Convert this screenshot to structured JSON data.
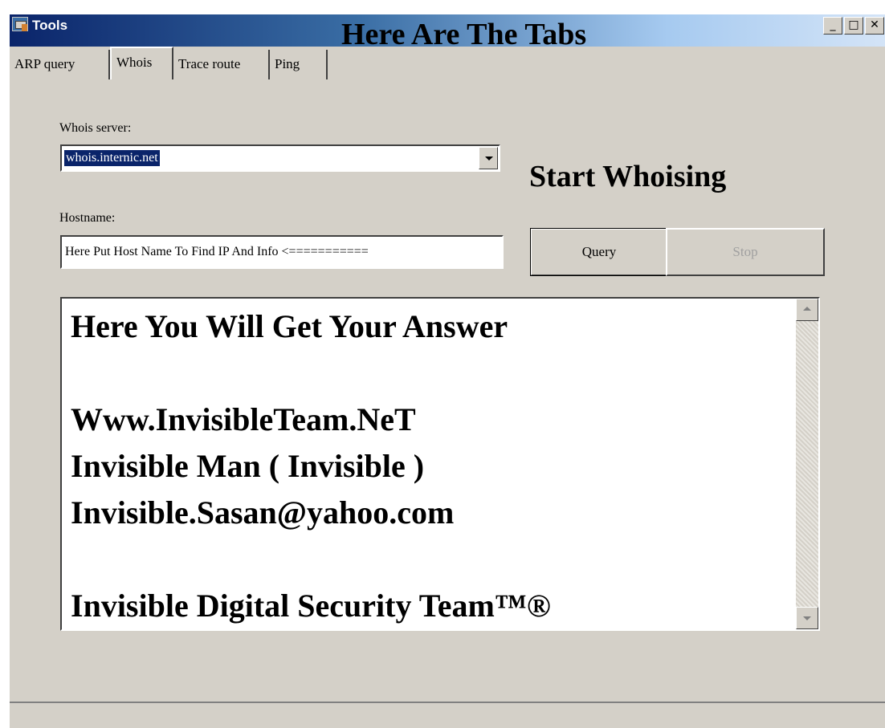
{
  "window": {
    "title": "Tools",
    "controls": [
      "minimize",
      "maximize",
      "close"
    ],
    "control_glyphs": {
      "minimize": "_",
      "maximize": "□",
      "close": "✕"
    }
  },
  "annotations": {
    "tabs_note": "Here Are The Tabs",
    "start_note": "Start Whoising"
  },
  "tabs": [
    {
      "label": "ARP query",
      "active": false
    },
    {
      "label": "Whois",
      "active": true
    },
    {
      "label": "Trace route",
      "active": false
    },
    {
      "label": "Ping",
      "active": false
    }
  ],
  "whois": {
    "server_label": "Whois server:",
    "server_value": "whois.internic.net",
    "hostname_label": "Hostname:",
    "hostname_value": "Here Put Host Name To Find IP And Info <===========",
    "query_label": "Query",
    "stop_label": "Stop",
    "stop_enabled": false
  },
  "output": {
    "lines": [
      "Here You Will Get Your Answer",
      "",
      "Www.InvisibleTeam.NeT",
      "Invisible Man ( Invisible )",
      "Invisible.Sasan@yahoo.com",
      "",
      "Invisible Digital Security Team™®"
    ]
  },
  "colors": {
    "face": "#d4d0c8",
    "title_start": "#0a246a",
    "selection": "#0a246a",
    "disabled_text": "#a0a0a0"
  }
}
